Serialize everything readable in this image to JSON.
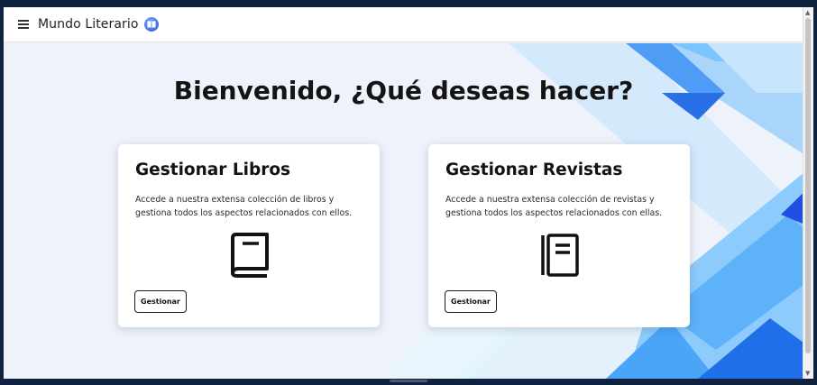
{
  "app": {
    "brand_name": "Mundo Literario",
    "logo_icon": "book-logo-icon",
    "menu_icon": "hamburger-menu-icon"
  },
  "main": {
    "welcome_title": "Bienvenido, ¿Qué deseas hacer?"
  },
  "cards": [
    {
      "title": "Gestionar Libros",
      "description": "Accede a nuestra extensa colección de libros y gestiona todos los aspectos relacionados con ellos.",
      "icon": "book-icon",
      "button_label": "Gestionar"
    },
    {
      "title": "Gestionar Revistas",
      "description": "Accede a nuestra extensa colección de revistas y gestiona todos los aspectos relacionados con ellas.",
      "icon": "magazine-icon",
      "button_label": "Gestionar"
    }
  ],
  "colors": {
    "accent_blue": "#1e6fe8",
    "light_blue": "#7cc4ff",
    "background": "#eef3fb",
    "frame": "#0f2340"
  }
}
